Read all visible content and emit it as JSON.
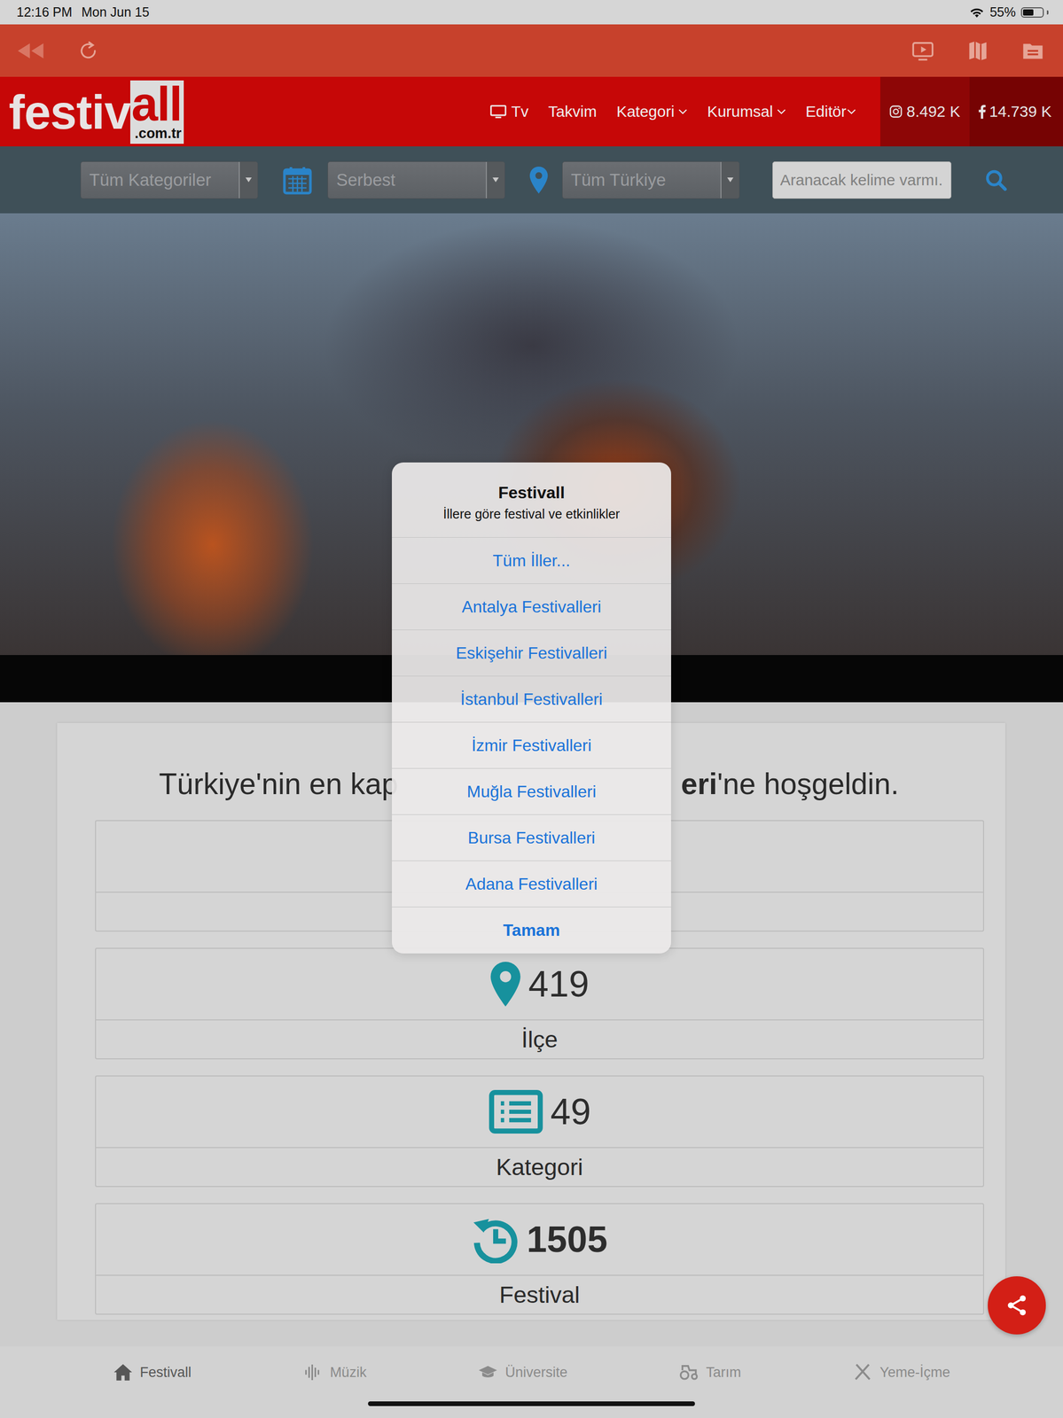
{
  "status_bar": {
    "time": "12:16 PM",
    "date": "Mon Jun 15",
    "battery": "55%",
    "battery_level": 0.55
  },
  "browser_toolbar": {
    "back_disabled": true
  },
  "site": {
    "logo": {
      "text": "festiv",
      "highlight": "all",
      "domain": ".com.tr"
    },
    "nav": [
      {
        "label": "Tv",
        "kind": "tv"
      },
      {
        "label": "Takvim",
        "kind": "plain"
      },
      {
        "label": "Kategori",
        "kind": "dropdown"
      },
      {
        "label": "Kurumsal",
        "kind": "dropdown"
      },
      {
        "label": "Editör",
        "kind": "dropdown"
      }
    ],
    "social": [
      {
        "kind": "instagram",
        "count": "8.492 K"
      },
      {
        "kind": "facebook",
        "count": "14.739 K"
      }
    ]
  },
  "filters": {
    "category": "Tüm Kategoriler",
    "date": "Serbest",
    "location": "Tüm Türkiye",
    "search_placeholder": "Aranacak kelime varmı."
  },
  "heading": {
    "before": "Türkiye'nin en kap",
    "bold": "eri",
    "after": "'ne hoşgeldin."
  },
  "stats": [
    {
      "kind": "covered",
      "number": "",
      "label": "",
      "bold": false
    },
    {
      "kind": "pin",
      "number": "419",
      "label": "İlçe",
      "bold": false
    },
    {
      "kind": "list",
      "number": "49",
      "label": "Kategori",
      "bold": false
    },
    {
      "kind": "history",
      "number": "1505",
      "label": "Festival",
      "bold": true
    }
  ],
  "tab_bar": [
    {
      "label": "Festivall",
      "kind": "home",
      "selected": true
    },
    {
      "label": "Müzik",
      "kind": "music",
      "selected": false
    },
    {
      "label": "Üniversite",
      "kind": "university",
      "selected": false
    },
    {
      "label": "Tarım",
      "kind": "farm",
      "selected": false
    },
    {
      "label": "Yeme-İçme",
      "kind": "food",
      "selected": false
    }
  ],
  "dialog": {
    "title": "Festivall",
    "message": "İllere göre festival ve etkinlikler",
    "actions": [
      {
        "label": "Tüm İller...",
        "kind": "default"
      },
      {
        "label": "Antalya Festivalleri",
        "kind": "default"
      },
      {
        "label": "Eskişehir Festivalleri",
        "kind": "default"
      },
      {
        "label": "İstanbul Festivalleri",
        "kind": "default"
      },
      {
        "label": "İzmir Festivalleri",
        "kind": "default"
      },
      {
        "label": "Muğla Festivalleri",
        "kind": "default"
      },
      {
        "label": "Bursa Festivalleri",
        "kind": "default"
      },
      {
        "label": "Adana Festivalleri",
        "kind": "default"
      },
      {
        "label": "Tamam",
        "kind": "cancel"
      }
    ]
  }
}
